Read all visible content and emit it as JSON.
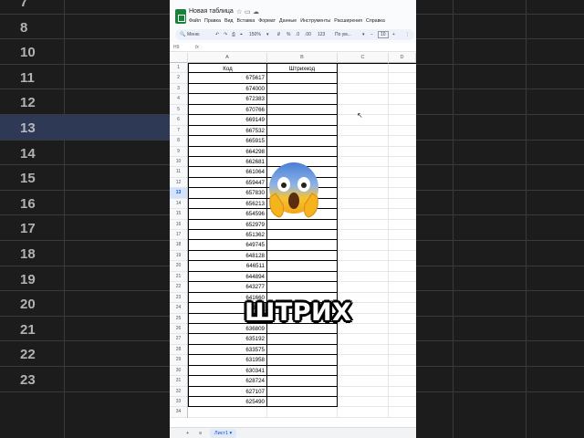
{
  "background": {
    "left_rows": [
      "7",
      "8",
      "10",
      "11",
      "12",
      "13",
      "14",
      "15",
      "16",
      "17",
      "18",
      "19",
      "20",
      "21",
      "22",
      "23"
    ],
    "highlight_row": "13"
  },
  "app": {
    "doc_title": "Новая таблица",
    "menu": [
      "Файл",
      "Правка",
      "Вид",
      "Вставка",
      "Формат",
      "Данные",
      "Инструменты",
      "Расширения",
      "Справка"
    ],
    "toolbar": {
      "search": "Меню",
      "zoom": "150%",
      "currency": "₽",
      "percent": "%",
      "decimals_dec": ".0",
      ".00": ".00",
      "format_123": "123",
      "font": "По ум...",
      "font_size": "10"
    },
    "name_box": "H9",
    "fx": "fx"
  },
  "grid": {
    "col_headers": [
      "A",
      "B",
      "C",
      "D"
    ],
    "header_row": {
      "a": "Код",
      "b": "Штрихкод"
    },
    "selected_row": "13",
    "codes": [
      "675617",
      "674000",
      "672383",
      "670766",
      "669149",
      "667532",
      "665915",
      "664298",
      "662681",
      "661064",
      "659447",
      "657830",
      "656213",
      "654596",
      "652979",
      "651362",
      "649745",
      "648128",
      "646511",
      "644894",
      "643277",
      "641660",
      "640043",
      "638426",
      "636809",
      "635192",
      "633575",
      "631958",
      "630341",
      "628724",
      "627107",
      "625490"
    ],
    "row_numbers": [
      "1",
      "2",
      "3",
      "4",
      "5",
      "6",
      "7",
      "8",
      "9",
      "10",
      "11",
      "12",
      "13",
      "14",
      "15",
      "16",
      "17",
      "18",
      "19",
      "20",
      "21",
      "22",
      "23",
      "24",
      "25",
      "26",
      "27",
      "28",
      "29",
      "30",
      "31",
      "32",
      "33",
      "34"
    ]
  },
  "sheetbar": {
    "add": "+",
    "list": "≡",
    "tab": "Лист1"
  },
  "overlay": {
    "caption": "ШТРИХ",
    "emoji": "face-screaming-in-fear"
  }
}
